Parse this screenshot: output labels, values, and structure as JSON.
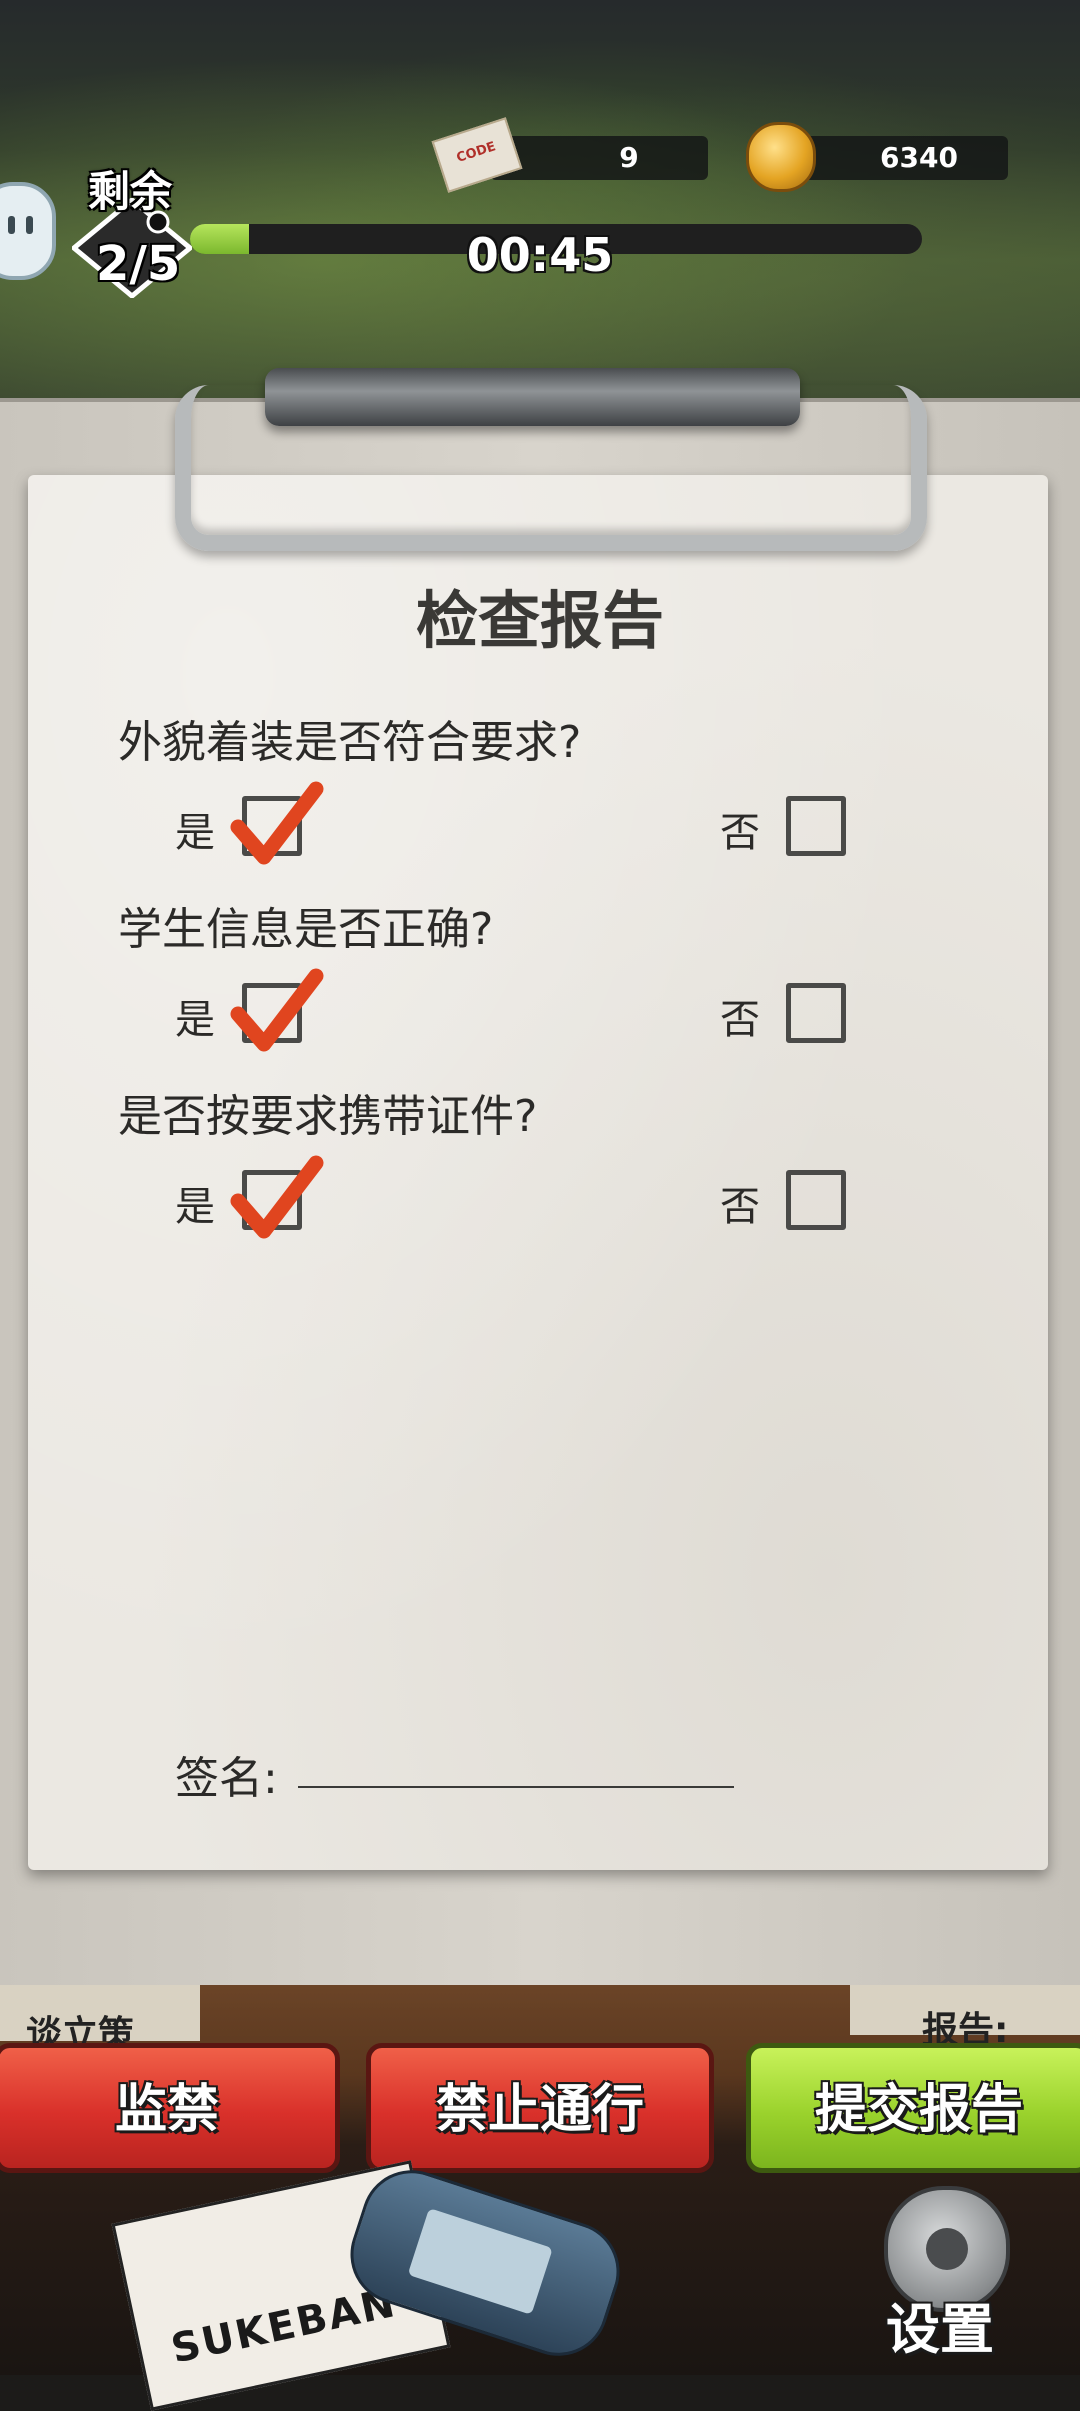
{
  "hud": {
    "remain_label": "剩余",
    "remain_count": "2/5",
    "progress_fraction": 0.08,
    "timer": "00:45",
    "code_icon_text": "CODE",
    "code_count": "9",
    "coin_count": "6340"
  },
  "report": {
    "title": "检查报告",
    "yes_label": "是",
    "no_label": "否",
    "questions": [
      {
        "text": "外貌着装是否符合要求?",
        "answer": "yes"
      },
      {
        "text": "学生信息是否正确?",
        "answer": "yes"
      },
      {
        "text": "是否按要求携带证件?",
        "answer": "yes"
      }
    ],
    "signature_label": "签名:",
    "signature_value": ""
  },
  "desk": {
    "left_doc_text": "谈立策",
    "right_doc_text": "报告:",
    "book_text": "SUKEBAN"
  },
  "actions": {
    "detain": "监禁",
    "deny": "禁止通行",
    "submit": "提交报告"
  },
  "settings_label": "设置",
  "colors": {
    "check_red": "#e0451f",
    "button_red": "#d9302a",
    "button_green": "#9ad22c",
    "progress_green": "#9ccf45"
  }
}
